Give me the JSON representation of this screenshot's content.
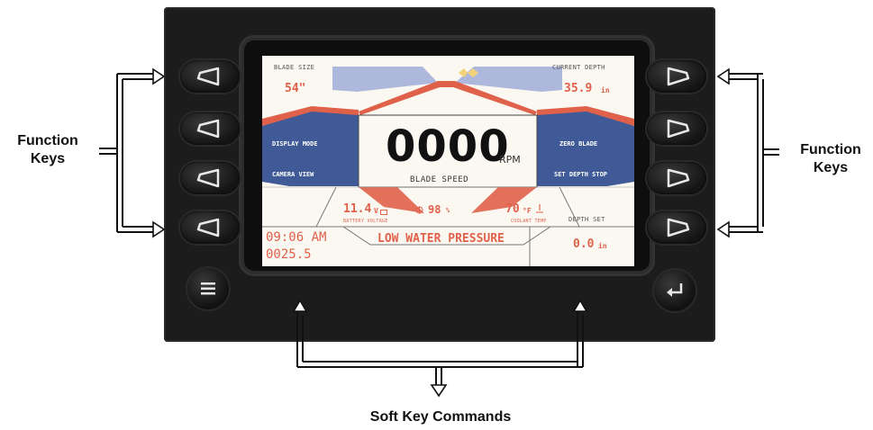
{
  "annotations": {
    "left_function_keys": [
      "Function",
      "Keys"
    ],
    "right_function_keys": [
      "Function",
      "Keys"
    ],
    "soft_key_commands": "Soft Key Commands"
  },
  "display": {
    "blade_size": {
      "title": "BLADE SIZE",
      "value": "54\""
    },
    "current_depth": {
      "title": "CURRENT DEPTH",
      "value": "35.9",
      "unit": "in"
    },
    "left_menu": [
      "DISPLAY MODE",
      "CAMERA VIEW"
    ],
    "right_menu": [
      "ZERO BLADE",
      "SET DEPTH STOP"
    ],
    "rpm": {
      "value": "0000",
      "unit": "RPM",
      "label": "BLADE SPEED"
    },
    "battery": {
      "value": "11.4",
      "unit": "V",
      "label": "BATTERY VOLTAGE"
    },
    "fuel": {
      "value": "98",
      "unit": "%"
    },
    "coolant": {
      "value": "70",
      "unit": "°F",
      "label": "COOLANT TEMP"
    },
    "depth_set": {
      "title": "DEPTH SET",
      "value": "0.0",
      "unit": "in"
    },
    "time": "09:06 AM",
    "hours": "0025.5",
    "alert": "LOW WATER PRESSURE"
  },
  "colors": {
    "accent": "#e0614a",
    "menu_fill": "#3f5a97",
    "light_fill": "#aeb8dc",
    "panel": "#1c1c1c"
  },
  "icons": [
    "left-triangle-icon",
    "right-triangle-icon",
    "menu-icon",
    "enter-icon",
    "arrow-icon"
  ]
}
